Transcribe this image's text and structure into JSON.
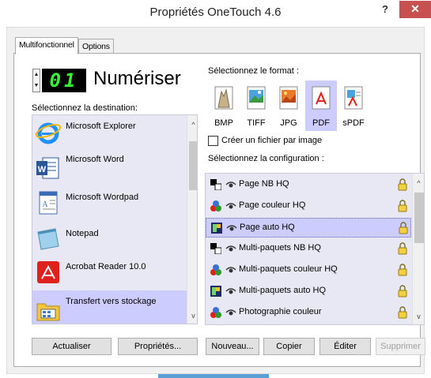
{
  "window": {
    "title": "Propriétés OneTouch 4.6",
    "help_label": "?",
    "close_label": "✕"
  },
  "tabs": [
    {
      "label": "Multifonctionnel",
      "active": true
    },
    {
      "label": "Options",
      "active": false
    }
  ],
  "scanner": {
    "lcd_value": "01",
    "action_label": "Numériser",
    "spin_up": "▲",
    "spin_down": "▼"
  },
  "destination": {
    "heading": "Sélectionnez la destination:",
    "items": [
      {
        "label": "Microsoft Explorer",
        "icon": "internet-explorer-icon",
        "selected": false
      },
      {
        "label": "Microsoft Word",
        "icon": "word-icon",
        "selected": false
      },
      {
        "label": "Microsoft Wordpad",
        "icon": "wordpad-icon",
        "selected": false
      },
      {
        "label": "Notepad",
        "icon": "notepad-icon",
        "selected": false
      },
      {
        "label": "Acrobat Reader 10.0",
        "icon": "acrobat-icon",
        "selected": false
      },
      {
        "label": "Transfert vers stockage",
        "icon": "storage-folder-icon",
        "selected": true
      }
    ]
  },
  "format": {
    "heading": "Sélectionnez le format :",
    "options": [
      {
        "label": "BMP",
        "selected": false
      },
      {
        "label": "TIFF",
        "selected": false
      },
      {
        "label": "JPG",
        "selected": false
      },
      {
        "label": "PDF",
        "selected": true
      },
      {
        "label": "sPDF",
        "selected": false
      }
    ],
    "one_file_per_image_label": "Créer un fichier par image",
    "one_file_per_image_checked": false
  },
  "configuration": {
    "heading": "Sélectionnez la configuration :",
    "items": [
      {
        "label": "Page NB HQ",
        "type": "bw",
        "selected": false
      },
      {
        "label": "Page couleur HQ",
        "type": "color",
        "selected": false
      },
      {
        "label": "Page auto HQ",
        "type": "auto",
        "selected": true
      },
      {
        "label": "Multi-paquets NB HQ",
        "type": "bw",
        "selected": false
      },
      {
        "label": "Multi-paquets couleur HQ",
        "type": "color",
        "selected": false
      },
      {
        "label": "Multi-paquets auto HQ",
        "type": "auto",
        "selected": false
      },
      {
        "label": "Photographie couleur",
        "type": "color",
        "selected": false
      }
    ]
  },
  "buttons": {
    "refresh": "Actualiser",
    "properties": "Propriétés...",
    "new": "Nouveau...",
    "copy": "Copier",
    "edit": "Éditer",
    "delete": "Supprimer"
  },
  "scroll_arrows": {
    "up": "^",
    "down": "v"
  },
  "colors": {
    "selection": "#ccccff",
    "list_bg": "#e8e8f5",
    "close_button": "#c75050",
    "lcd_digits": "#33ff33"
  }
}
